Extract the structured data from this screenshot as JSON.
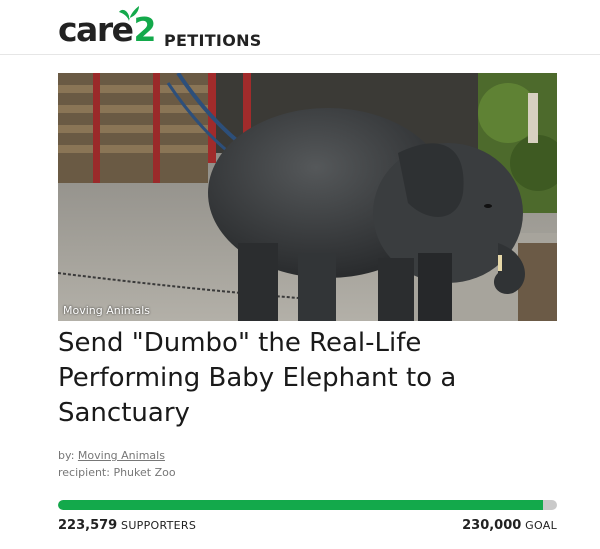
{
  "brand": {
    "name_word": "care",
    "name_number": "2",
    "section": "PETITIONS",
    "accent_color": "#13a94b"
  },
  "hero": {
    "image_subject": "baby elephant walking in a zoo enclosure",
    "caption": "Moving Animals"
  },
  "petition": {
    "title": "Send \"Dumbo\" the Real-Life Performing Baby Elephant to a Sanctuary",
    "by_label": "by:",
    "author": "Moving Animals",
    "recipient_label": "recipient:",
    "recipient": "Phuket Zoo"
  },
  "progress": {
    "supporters": "223,579",
    "supporters_label": "SUPPORTERS",
    "goal": "230,000",
    "goal_label": "GOAL",
    "fraction": 0.972
  }
}
